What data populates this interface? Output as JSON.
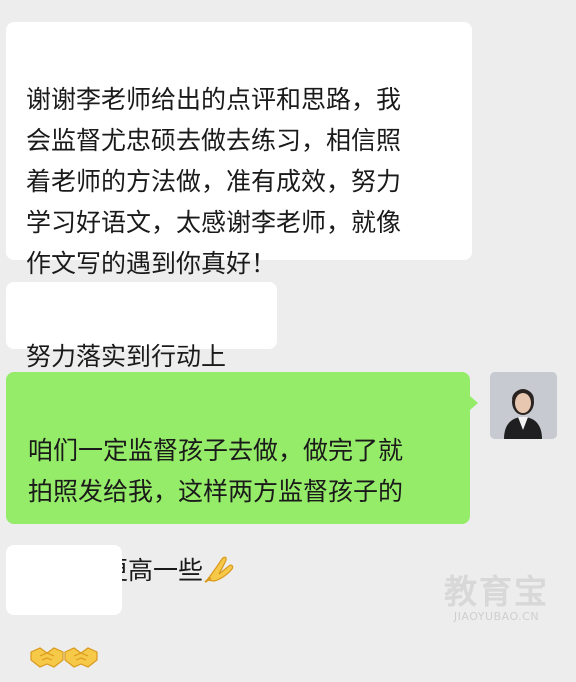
{
  "messages": [
    {
      "direction": "incoming",
      "text": "谢谢李老师给出的点评和思路，我\n会监督尤忠硕去做去练习，相信照\n着老师的方法做，准有成效，努力\n学习好语文，太感谢李老师，就像\n作文写的遇到你真好！"
    },
    {
      "direction": "incoming",
      "text": "努力落实到行动上"
    },
    {
      "direction": "outgoing",
      "text": "咱们一定监督孩子去做，做完了就\n拍照发给我，这样两方监督孩子的\n效率会更高一些",
      "emoji": "praying-hands-icon"
    },
    {
      "direction": "incoming",
      "emoji": [
        "handshake-icon",
        "handshake-icon"
      ]
    }
  ],
  "colors": {
    "background": "#ededed",
    "incoming_bubble": "#ffffff",
    "outgoing_bubble": "#95ec69"
  },
  "watermark": {
    "main": "教育宝",
    "sub": "JIAOYUBAO.CN"
  }
}
